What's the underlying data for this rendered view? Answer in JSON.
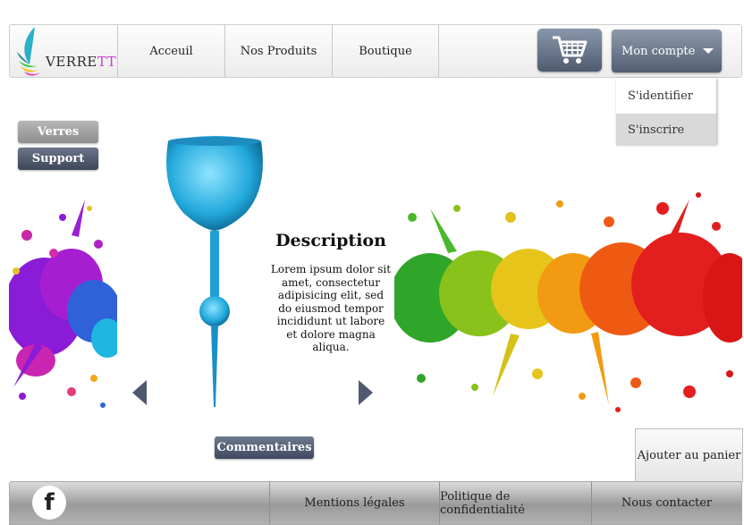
{
  "brand": {
    "name_part1": "VERRE",
    "name_part2": "TT"
  },
  "nav": {
    "items": [
      "Acceuil",
      "Nos Produits",
      "Boutique"
    ]
  },
  "header": {
    "cart_icon": "shopping-cart-icon",
    "account_label": "Mon compte"
  },
  "account_menu": {
    "items": [
      "S'identifier",
      "S'inscrire"
    ],
    "highlighted": "S'inscrire"
  },
  "side_buttons": {
    "verres": "Verres",
    "support": "Support"
  },
  "product": {
    "description_title": "Description",
    "description_text": "Lorem ipsum dolor sit amet, consectetur adipisicing elit, sed do eiusmod tempor incididunt ut labore et dolore magna aliqua."
  },
  "actions": {
    "comments": "Commentaires",
    "add_to_cart": "Ajouter au panier"
  },
  "footer": {
    "social_icon": "facebook-icon",
    "links": [
      "Mentions légales",
      "Politique de confidentialité",
      "Nous contacter"
    ]
  },
  "colors": {
    "accent": "#4f5a70",
    "brand_pink": "#c83bd6"
  }
}
